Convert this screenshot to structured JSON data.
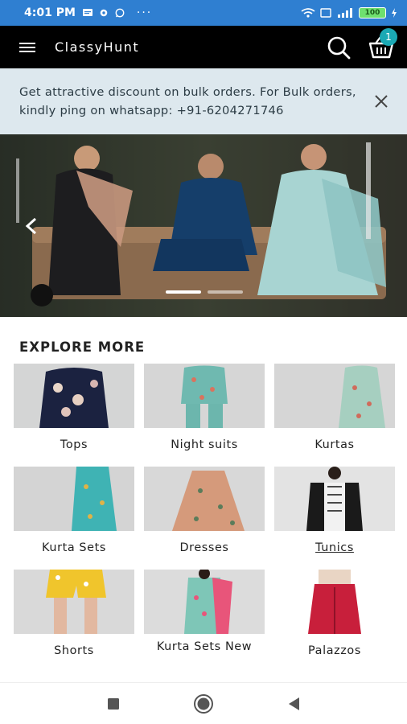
{
  "status_bar": {
    "time": "4:01 PM",
    "battery": "100"
  },
  "app": {
    "title": "ClassyHunt",
    "cart_count": "1"
  },
  "notice": {
    "message": "Get attractive discount on bulk orders. For Bulk orders, kindly ping on whatsapp: +91-6204271746"
  },
  "hero": {
    "slide_count": 2,
    "active_slide": 1
  },
  "explore": {
    "title": "EXPLORE MORE",
    "categories": [
      {
        "label": "Tops"
      },
      {
        "label": "Night suits"
      },
      {
        "label": "Kurtas"
      },
      {
        "label": "Kurta Sets"
      },
      {
        "label": "Dresses"
      },
      {
        "label": "Tunics"
      },
      {
        "label": "Shorts"
      },
      {
        "label": "Kurta Sets New"
      },
      {
        "label": "Palazzos"
      }
    ]
  },
  "colors": {
    "status_bar": "#2f7fd1",
    "app_bar": "#000000",
    "notice_bg": "#dde8ee",
    "badge": "#1ba9b4"
  }
}
